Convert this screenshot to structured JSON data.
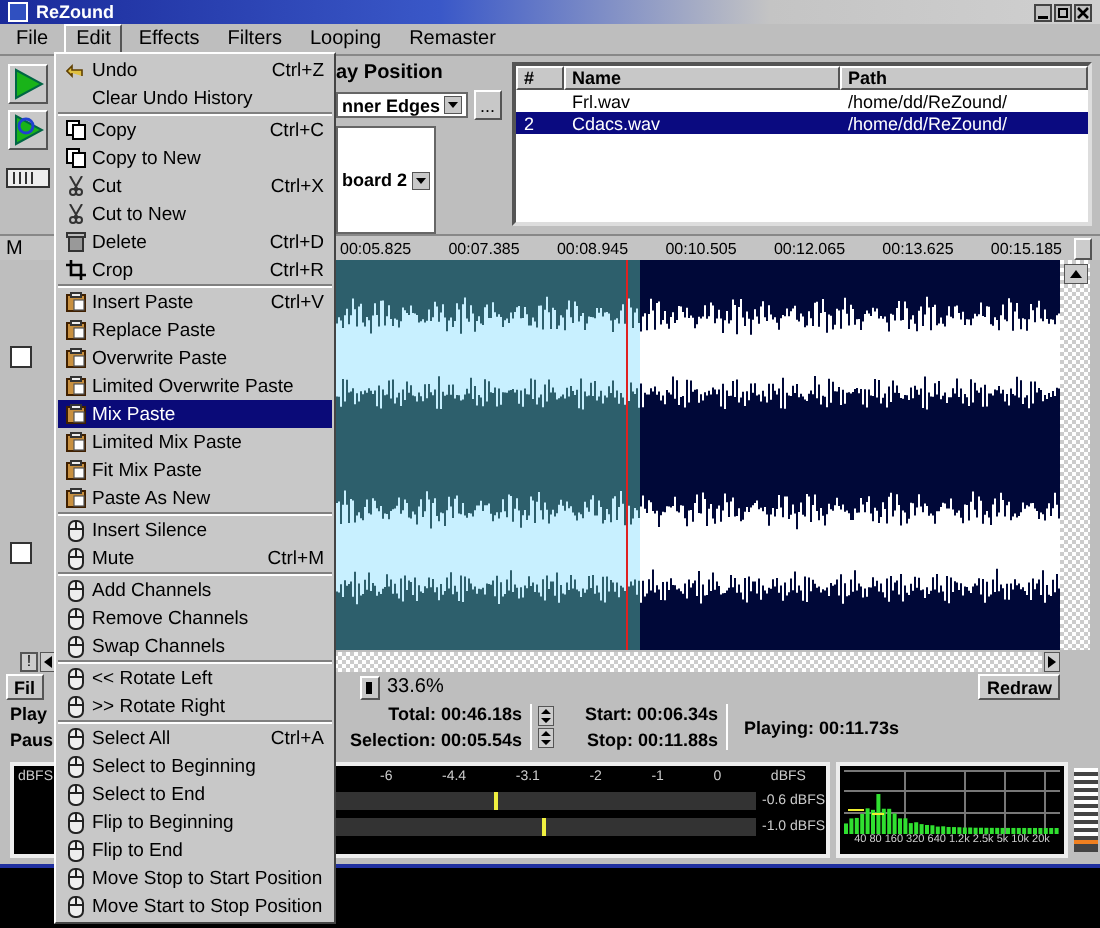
{
  "window": {
    "title": "ReZound"
  },
  "menubar": [
    {
      "label": "File",
      "selected": false
    },
    {
      "label": "Edit",
      "selected": true
    },
    {
      "label": "Effects",
      "selected": false
    },
    {
      "label": "Filters",
      "selected": false
    },
    {
      "label": "Looping",
      "selected": false
    },
    {
      "label": "Remaster",
      "selected": false
    }
  ],
  "edit_menu": {
    "sections": [
      [
        {
          "label": "Undo",
          "shortcut": "Ctrl+Z",
          "kind": "undo",
          "selected": false
        },
        {
          "label": "Clear Undo History",
          "kind": "none",
          "selected": false
        }
      ],
      [
        {
          "label": "Copy",
          "shortcut": "Ctrl+C",
          "kind": "copy",
          "selected": false
        },
        {
          "label": "Copy to New",
          "kind": "copy",
          "selected": false
        },
        {
          "label": "Cut",
          "shortcut": "Ctrl+X",
          "kind": "cut",
          "selected": false
        },
        {
          "label": "Cut to New",
          "kind": "cut",
          "selected": false
        },
        {
          "label": "Delete",
          "shortcut": "Ctrl+D",
          "kind": "delete",
          "selected": false
        },
        {
          "label": "Crop",
          "shortcut": "Ctrl+R",
          "kind": "crop",
          "selected": false
        }
      ],
      [
        {
          "label": "Insert Paste",
          "shortcut": "Ctrl+V",
          "kind": "paste",
          "selected": false
        },
        {
          "label": "Replace Paste",
          "kind": "paste",
          "selected": false
        },
        {
          "label": "Overwrite Paste",
          "kind": "paste",
          "selected": false
        },
        {
          "label": "Limited Overwrite Paste",
          "kind": "paste",
          "selected": false
        },
        {
          "label": "Mix Paste",
          "kind": "paste",
          "selected": true
        },
        {
          "label": "Limited Mix Paste",
          "kind": "paste",
          "selected": false
        },
        {
          "label": "Fit Mix Paste",
          "kind": "paste",
          "selected": false
        },
        {
          "label": "Paste As New",
          "kind": "paste",
          "selected": false
        }
      ],
      [
        {
          "label": "Insert Silence",
          "kind": "mouse",
          "selected": false
        },
        {
          "label": "Mute",
          "shortcut": "Ctrl+M",
          "kind": "mouse",
          "selected": false
        }
      ],
      [
        {
          "label": "Add Channels",
          "kind": "mouse",
          "selected": false
        },
        {
          "label": "Remove Channels",
          "kind": "mouse",
          "selected": false
        },
        {
          "label": "Swap Channels",
          "kind": "mouse",
          "selected": false
        }
      ],
      [
        {
          "label": "<< Rotate Left",
          "kind": "mouse",
          "selected": false
        },
        {
          "label": ">> Rotate Right",
          "kind": "mouse",
          "selected": false
        }
      ],
      [
        {
          "label": "Select All",
          "shortcut": "Ctrl+A",
          "kind": "mouse",
          "selected": false
        },
        {
          "label": "Select to Beginning",
          "kind": "mouse",
          "selected": false
        },
        {
          "label": "Select to End",
          "kind": "mouse",
          "selected": false
        },
        {
          "label": "Flip to Beginning",
          "kind": "mouse",
          "selected": false
        },
        {
          "label": "Flip to End",
          "kind": "mouse",
          "selected": false
        },
        {
          "label": "Move Stop to Start Position",
          "kind": "mouse",
          "selected": false
        },
        {
          "label": "Move Start to Stop Position",
          "kind": "mouse",
          "selected": false
        }
      ]
    ]
  },
  "play_controls": {
    "label": "ay Position",
    "mode": "nner Edges",
    "more": "...",
    "clipboard": "board 2"
  },
  "files_table": {
    "columns": [
      "#",
      "Name",
      "Path"
    ],
    "rows": [
      {
        "name": "Frl.wav",
        "path": "/home/dd/ReZound/",
        "selected": false
      },
      {
        "number": "2",
        "name": "Cdacs.wav",
        "path": "/home/dd/ReZound/",
        "selected": true
      }
    ]
  },
  "ruler": {
    "marker": "M",
    "labels": [
      "00:05.825",
      "00:07.385",
      "00:08.945",
      "00:10.505",
      "00:12.065",
      "00:13.625",
      "00:15.185"
    ]
  },
  "channels": [
    {
      "checked": false
    },
    {
      "checked": false
    }
  ],
  "hscroll": {
    "button": "!"
  },
  "zoom_row": {
    "button": "Fil",
    "zoom": "33.6%",
    "redraw": "Redraw"
  },
  "info": {
    "play": "Play",
    "pause": "Paus",
    "total": "Total: 00:46.18s",
    "selection": "Selection: 00:05.54s",
    "start": "Start: 00:06.34s",
    "stop": "Stop: 00:11.88s",
    "playing": "Playing: 00:11.73s"
  },
  "meters": {
    "caption": "dBFS",
    "ticks": [
      "-6",
      "-4.4",
      "-3.1",
      "-2",
      "-1",
      "0",
      "dBFS"
    ],
    "channels": [
      {
        "level": 0.62,
        "reading": "-0.6 dBFS"
      },
      {
        "level": 0.69,
        "reading": "-1.0 dBFS"
      }
    ]
  },
  "analyzer": {
    "labels": "40 80 160 320 640 1.2k 2.5k 5k 10k 20k"
  }
}
